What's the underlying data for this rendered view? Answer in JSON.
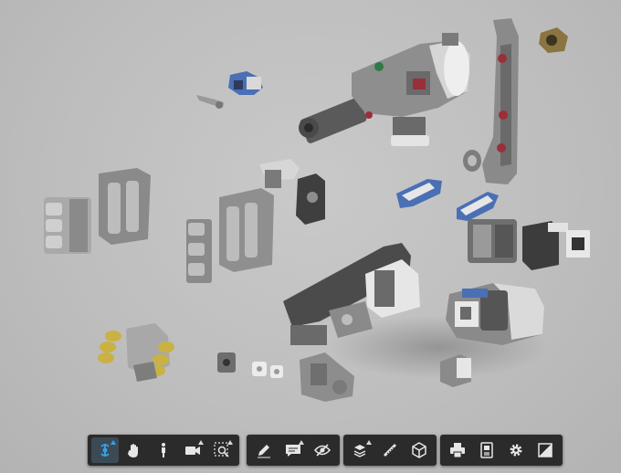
{
  "colors": {
    "background": "#c2c2c2",
    "toolbar": "#2b2b2b",
    "icon": "#e6e6e6",
    "active_icon": "#35a3e8",
    "part_dark": "#4a4a4a",
    "part_grey": "#8e8e8e",
    "part_light": "#e8e8e8",
    "part_blue": "#4a6fb5",
    "part_red": "#9a2f3a",
    "part_yellow": "#c9b243"
  },
  "toolbar": {
    "groups": [
      {
        "name": "navigation",
        "tools": [
          {
            "icon": "orbit-icon",
            "active": true,
            "has_menu": true
          },
          {
            "icon": "pan-hand-icon",
            "active": false,
            "has_menu": false
          },
          {
            "icon": "person-walk-icon",
            "active": false,
            "has_menu": false
          },
          {
            "icon": "camera-icon",
            "active": false,
            "has_menu": true
          },
          {
            "icon": "zoom-window-icon",
            "active": false,
            "has_menu": true
          }
        ]
      },
      {
        "name": "review",
        "tools": [
          {
            "icon": "markup-pen-icon",
            "active": false,
            "has_menu": false
          },
          {
            "icon": "comment-icon",
            "active": false,
            "has_menu": true
          },
          {
            "icon": "visibility-icon",
            "active": false,
            "has_menu": false
          }
        ]
      },
      {
        "name": "model",
        "tools": [
          {
            "icon": "explode-icon",
            "active": false,
            "has_menu": true
          },
          {
            "icon": "measure-icon",
            "active": false,
            "has_menu": false
          },
          {
            "icon": "section-cube-icon",
            "active": false,
            "has_menu": false
          }
        ]
      },
      {
        "name": "view",
        "tools": [
          {
            "icon": "print-icon",
            "active": false,
            "has_menu": false
          },
          {
            "icon": "model-browser-icon",
            "active": false,
            "has_menu": false
          },
          {
            "icon": "settings-gear-icon",
            "active": false,
            "has_menu": false
          },
          {
            "icon": "fullscreen-icon",
            "active": false,
            "has_menu": false
          }
        ]
      }
    ]
  }
}
